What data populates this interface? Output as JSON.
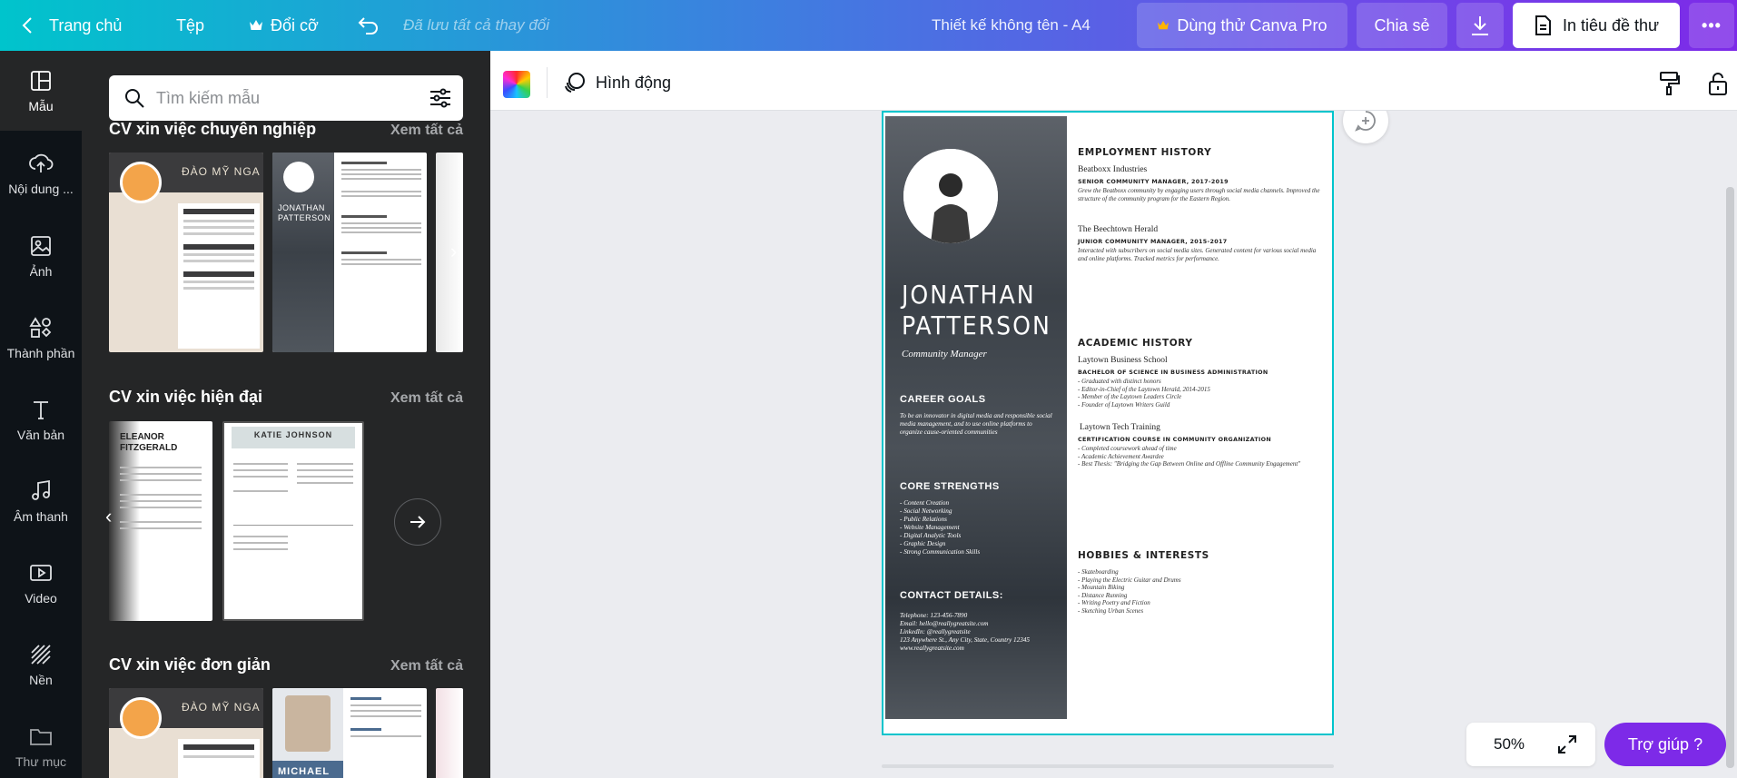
{
  "topbar": {
    "home_label": "Trang chủ",
    "file_label": "Tệp",
    "resize_label": "Đổi cỡ",
    "saved_status": "Đã lưu tất cả thay đổi",
    "design_title": "Thiết kế không tên - A4",
    "pro_label": "Dùng thử Canva Pro",
    "share_label": "Chia sẻ",
    "print_label": "In tiêu đề thư",
    "more_label": "•••"
  },
  "rail": [
    {
      "label": "Mẫu",
      "icon": "template-icon"
    },
    {
      "label": "Nội dung ...",
      "icon": "upload-icon"
    },
    {
      "label": "Ảnh",
      "icon": "photo-icon"
    },
    {
      "label": "Thành phần",
      "icon": "elements-icon"
    },
    {
      "label": "Văn bản",
      "icon": "text-icon"
    },
    {
      "label": "Âm thanh",
      "icon": "music-icon"
    },
    {
      "label": "Video",
      "icon": "video-icon"
    },
    {
      "label": "Nền",
      "icon": "background-icon"
    },
    {
      "label": "Thư mục",
      "icon": "folder-icon"
    }
  ],
  "panel": {
    "search_placeholder": "Tìm kiếm mẫu",
    "see_all": "Xem tất cả",
    "sections": [
      {
        "title": "CV xin việc chuyên nghiệp"
      },
      {
        "title": "CV xin việc hiện đại"
      },
      {
        "title": "CV xin việc đơn giản"
      }
    ],
    "thumbs": {
      "dao_my_nga": "ĐÀO MỸ NGA",
      "jonathan": "JONATHAN PATTERSON",
      "eleanor": "ELEANOR FITZGERALD",
      "katie": "KATIE JOHNSON",
      "michael": "MICHAEL"
    }
  },
  "toolbar": {
    "animate_label": "Hình động"
  },
  "cv": {
    "first_name": "JONATHAN",
    "last_name": "PATTERSON",
    "role": "Community Manager",
    "career_goals_title": "CAREER GOALS",
    "career_goals_text": "To be an innovator in digital media and responsible social media management, and to use online platforms to organize cause-oriented communities",
    "core_strengths_title": "CORE STRENGTHS",
    "core_strengths": [
      "- Content Creation",
      "- Social Networking",
      "- Public Relations",
      "- Website Management",
      "- Digital Analytic Tools",
      "- Graphic Design",
      "- Strong Communication Skills"
    ],
    "contact_title": "CONTACT DETAILS:",
    "contact": [
      "Telephone: 123-456-7890",
      "Email: hello@reallygreatsite.com",
      "LinkedIn: @reallygreatsite",
      "123 Anywhere St., Any City, State, Country 12345",
      "www.reallygreatsite.com"
    ],
    "employment_title": "EMPLOYMENT HISTORY",
    "job1_org": "Beatboxx Industries",
    "job1_role": "SENIOR COMMUNITY MANAGER, 2017-2019",
    "job1_desc": "Grew the Beatboxx community by engaging users through social media channels. Improved the structure of the community program for the Eastern Region.",
    "job2_org": "The Beechtown Herald",
    "job2_role": "JUNIOR COMMUNITY MANAGER, 2015-2017",
    "job2_desc": "Interacted with subscribers on social media sites. Generated content for various social media and online platforms. Tracked metrics for performance.",
    "academic_title": "ACADEMIC HISTORY",
    "school1": "Laytown Business School",
    "school1_degree": "BACHELOR OF SCIENCE IN BUSINESS ADMINISTRATION",
    "school1_items": [
      "- Graduated with distinct honors",
      "- Editor-in-Chief of the Laytown Herald, 2014-2015",
      "- Member of the Laytown Leaders Circle",
      "- Founder of Laytown Writers Guild"
    ],
    "school2": "Laytown Tech Training",
    "school2_degree": "CERTIFICATION COURSE IN COMMUNITY ORGANIZATION",
    "school2_items": [
      "- Completed coursework ahead of time",
      "- Academic Achievement Awardee",
      "- Best Thesis: \"Bridging the Gap Between Online and Offline Community Engagement\""
    ],
    "hobbies_title": "HOBBIES & INTERESTS",
    "hobbies": [
      "- Skateboarding",
      "- Playing the Electric Guitar and Drums",
      "- Mountain Biking",
      "- Distance Running",
      "- Writing Poetry and Fiction",
      "- Sketching Urban Scenes"
    ]
  },
  "footer": {
    "zoom": "50%",
    "help_label": "Trợ giúp  ?"
  },
  "colors": {
    "accent": "#00c4cc",
    "brand_purple": "#7d2ae8",
    "panel_bg": "#252627",
    "rail_bg": "#0e1318"
  }
}
